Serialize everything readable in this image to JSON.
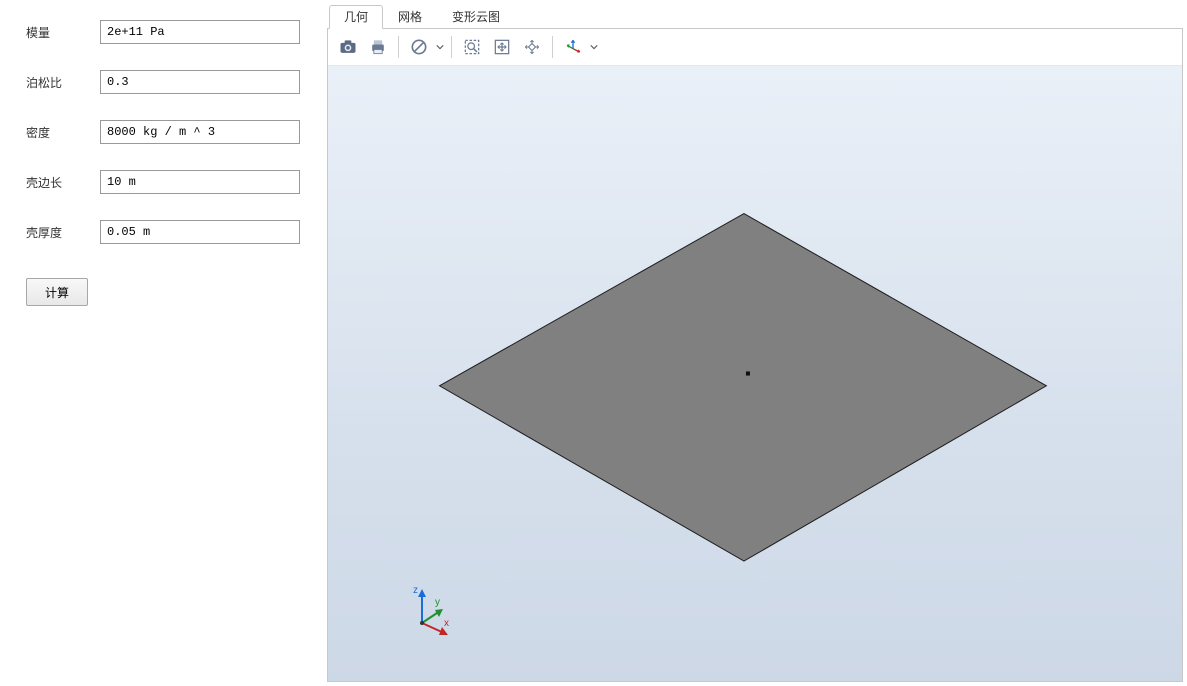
{
  "form": {
    "fields": [
      {
        "label": "模量",
        "value": "2e+11 Pa"
      },
      {
        "label": "泊松比",
        "value": "0.3"
      },
      {
        "label": "密度",
        "value": "8000 kg / m ^ 3"
      },
      {
        "label": "壳边长",
        "value": "10 m"
      },
      {
        "label": "壳厚度",
        "value": "0.05 m"
      }
    ],
    "calc_label": "计算"
  },
  "tabs": {
    "items": [
      {
        "label": "几何",
        "active": true
      },
      {
        "label": "网格",
        "active": false
      },
      {
        "label": "变形云图",
        "active": false
      }
    ]
  },
  "toolbar": {
    "camera": "camera-icon",
    "print": "print-icon",
    "no_block": "no-symbol-icon",
    "zoom_window": "zoom-window-icon",
    "fit_view": "fit-view-icon",
    "zoom_extents": "zoom-extents-icon",
    "axes_view": "axes-view-icon"
  },
  "triad": {
    "x": "x",
    "y": "y",
    "z": "z"
  },
  "colors": {
    "sky_top": "#e8eff7",
    "sky_bottom": "#cfdae8",
    "plate_fill": "#808080",
    "plate_edge": "#222222"
  }
}
